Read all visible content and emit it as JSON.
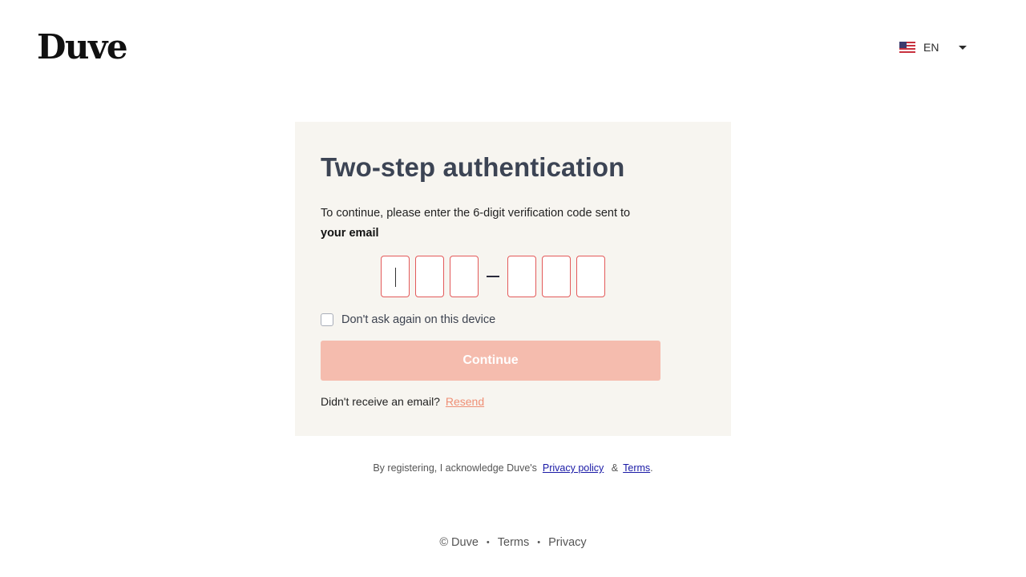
{
  "brand": {
    "logo_text": "Duve"
  },
  "language": {
    "code": "EN",
    "flag_icon": "us-flag-icon"
  },
  "card": {
    "title": "Two-step authentication",
    "description_prefix": "To continue, please enter the 6-digit verification code sent to ",
    "description_bold": "your email",
    "code_digits": [
      "",
      "",
      "",
      "",
      "",
      ""
    ],
    "remember_label": "Don't ask again on this device",
    "continue_label": "Continue",
    "resend_prompt": "Didn't receive an email?",
    "resend_label": "Resend"
  },
  "legal": {
    "prefix": "By registering, I acknowledge Duve's",
    "privacy_label": "Privacy policy",
    "amp": "&",
    "terms_label": "Terms",
    "suffix": "."
  },
  "footer": {
    "copyright": "© Duve",
    "separator": "•",
    "terms": "Terms",
    "privacy": "Privacy"
  },
  "colors": {
    "accent": "#ef8f75",
    "button_disabled": "#f5bcae",
    "digit_border": "#e35a5a",
    "card_bg": "#f7f5f0",
    "title": "#3c4454"
  }
}
